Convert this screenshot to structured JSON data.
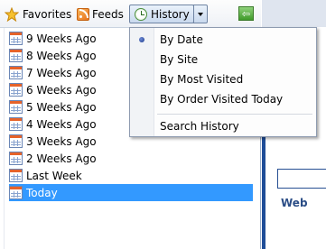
{
  "toolbar": {
    "favorites_label": "Favorites",
    "feeds_label": "Feeds",
    "history_label": "History",
    "icons": [
      "star-icon",
      "rss-feed-icon",
      "history-clock-icon",
      "chevron-down-icon",
      "sync-green-arrow-icon"
    ]
  },
  "history_list": {
    "items": [
      {
        "label": "9 Weeks Ago",
        "selected": false
      },
      {
        "label": "8 Weeks Ago",
        "selected": false
      },
      {
        "label": "7 Weeks Ago",
        "selected": false
      },
      {
        "label": "6 Weeks Ago",
        "selected": false
      },
      {
        "label": "5 Weeks Ago",
        "selected": false
      },
      {
        "label": "4 Weeks Ago",
        "selected": false
      },
      {
        "label": "3 Weeks Ago",
        "selected": false
      },
      {
        "label": "2 Weeks Ago",
        "selected": false
      },
      {
        "label": "Last Week",
        "selected": false
      },
      {
        "label": "Today",
        "selected": true
      }
    ]
  },
  "view_menu": {
    "items": [
      {
        "label": "By Date",
        "checked": true
      },
      {
        "label": "By Site",
        "checked": false
      },
      {
        "label": "By Most Visited",
        "checked": false
      },
      {
        "label": "By Order Visited Today",
        "checked": false
      },
      {
        "label": "Search History",
        "checked": false
      }
    ]
  },
  "background_page": {
    "web_tab_label": "Web"
  },
  "colors": {
    "selection": "#3399ff",
    "calendar_header": "#e6632a",
    "page_accent": "#1f4d98"
  }
}
